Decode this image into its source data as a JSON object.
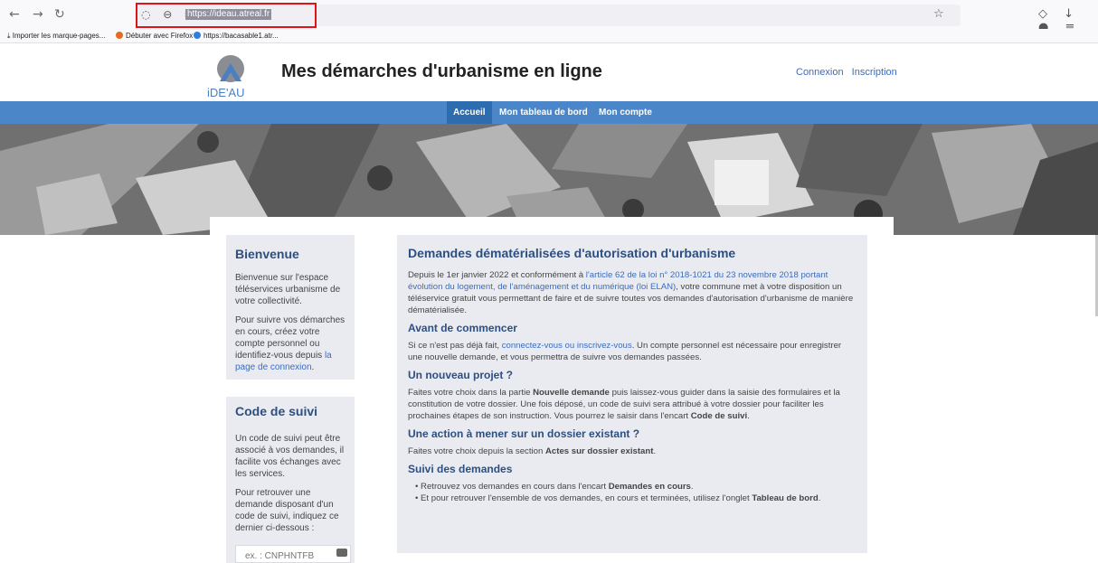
{
  "browser": {
    "url": "https://ideau.atreal.fr",
    "bookmarks": [
      "Importer les marque-pages...",
      "Débuter avec Firefox",
      "https://bacasable1.atr..."
    ]
  },
  "header": {
    "logo_text": "iDE'AU",
    "title": "Mes démarches d'urbanisme en ligne",
    "login_link": "Connexion",
    "register_link": "Inscription"
  },
  "nav": {
    "items": [
      "Accueil",
      "Mon tableau de bord",
      "Mon compte"
    ]
  },
  "welcome": {
    "title": "Bienvenue",
    "p1": "Bienvenue sur l'espace téléservices urbanisme de votre collectivité.",
    "p2_prefix": "Pour suivre vos démarches en cours, créez votre compte personnel ou identifiez-vous depuis ",
    "p2_link": "la page de connexion",
    "p2_suffix": "."
  },
  "tracking": {
    "title": "Code de suivi",
    "p1": "Un code de suivi peut être associé à vos demandes, il facilite vos échanges avec les services.",
    "p2": "Pour retrouver une demande disposant d'un code de suivi, indiquez ce dernier ci-dessous :",
    "input_placeholder": "ex. : CNPHNTFB"
  },
  "main": {
    "title": "Demandes dématérialisées d'autorisation d'urbanisme",
    "intro_prefix": "Depuis le 1er janvier 2022 et conformément à ",
    "intro_link": "l'article 62 de la loi n° 2018-1021 du 23 novembre 2018 portant évolution du logement, de l'aménagement et du numérique (loi ELAN)",
    "intro_suffix": ", votre commune met à votre disposition un téléservice gratuit vous permettant de faire et de suivre toutes vos demandes d'autorisation d'urbanisme de manière dématérialisée.",
    "s1_title": "Avant de commencer",
    "s1_prefix": "Si ce n'est pas déjà fait, ",
    "s1_link": "connectez-vous ou inscrivez-vous",
    "s1_suffix": ". Un compte personnel est nécessaire pour enregistrer une nouvelle demande, et vous permettra de suivre vos demandes passées.",
    "s2_title": "Un nouveau projet ?",
    "s2_a": "Faites votre choix dans la partie ",
    "s2_b": "Nouvelle demande",
    "s2_c": " puis laissez-vous guider dans la saisie des formulaires et la constitution de votre dossier. Une fois déposé, un code de suivi sera attribué à votre dossier pour faciliter les prochaines étapes de son instruction. Vous pourrez le saisir dans l'encart ",
    "s2_d": "Code de suivi",
    "s2_e": ".",
    "s3_title": "Une action à mener sur un dossier existant ?",
    "s3_a": "Faites votre choix depuis la section ",
    "s3_b": "Actes sur dossier existant",
    "s3_c": ".",
    "s4_title": "Suivi des demandes",
    "b1_a": "Retrouvez vos demandes en cours dans l'encart ",
    "b1_b": "Demandes en cours",
    "b1_c": ".",
    "b2_a": "Et pour retrouver l'ensemble de vos demandes, en cours et terminées, utilisez l'onglet ",
    "b2_b": "Tableau de bord",
    "b2_c": "."
  },
  "colors": {
    "accent": "#4a86c8",
    "heading": "#2d4f80",
    "link": "#3a6cc0",
    "card_bg": "#e9ebf1"
  }
}
